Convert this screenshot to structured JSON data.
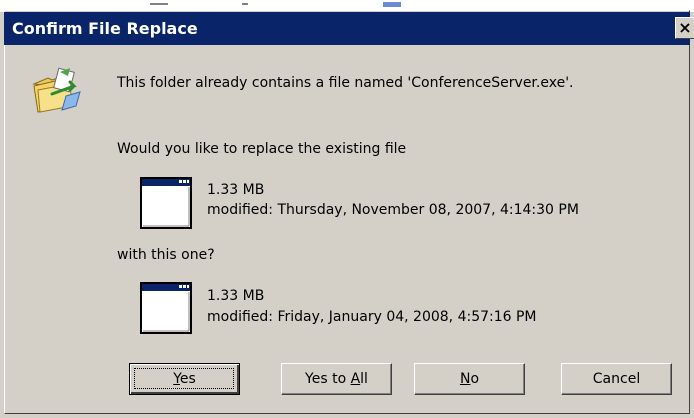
{
  "dialog": {
    "title": "Confirm File Replace",
    "close_label": "×"
  },
  "message": {
    "intro": "This folder already contains a file named 'ConferenceServer.exe'.",
    "question": "Would you like to replace the existing file",
    "with_this": "with this one?"
  },
  "existing_file": {
    "size": "1.33 MB",
    "modified": "modified: Thursday, November 08, 2007, 4:14:30 PM"
  },
  "new_file": {
    "size": "1.33 MB",
    "modified": "modified: Friday, January 04, 2008, 4:57:16 PM"
  },
  "buttons": {
    "yes": {
      "label": "Yes",
      "accel": "Y",
      "rest": "es"
    },
    "yes_to_all": {
      "pre": "Yes to ",
      "accel": "A",
      "rest": "ll"
    },
    "no": {
      "accel": "N",
      "rest": "o"
    },
    "cancel": {
      "label": "Cancel"
    }
  },
  "icons": {
    "title_close": "close-icon",
    "header": "folder-replace-icon",
    "file": "application-window-icon"
  },
  "colors": {
    "titlebar": "#0a246a",
    "dialog_bg": "#d4d0c8"
  }
}
